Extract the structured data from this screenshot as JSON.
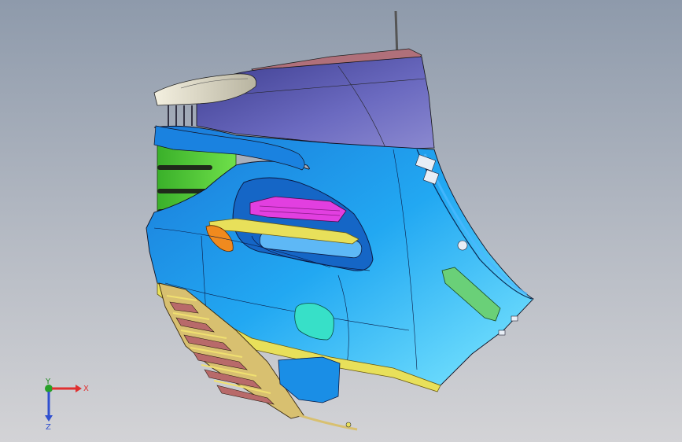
{
  "viewport": {
    "background_top": "#8e9aab",
    "background_bottom": "#d3d3d6"
  },
  "model": {
    "parts": [
      {
        "name": "upper-quarter-panel",
        "color": "#5e5db0"
      },
      {
        "name": "rear-bumper-fascia",
        "color": "#1fa0f0"
      },
      {
        "name": "tail-lamp-housing",
        "color": "#e8e4d0"
      },
      {
        "name": "inner-bracket",
        "color": "#3fc83c"
      },
      {
        "name": "reflector-insert",
        "color": "#e23fe0"
      },
      {
        "name": "trim-strip",
        "color": "#e8e05a"
      },
      {
        "name": "side-marker",
        "color": "#f08a1e"
      },
      {
        "name": "sensor-pad",
        "color": "#37e0c8"
      },
      {
        "name": "mount-bracket",
        "color": "#6ad078"
      },
      {
        "name": "lower-grille",
        "color": "#d8c070"
      }
    ]
  },
  "triad": {
    "x_label": "X",
    "y_label": "Y",
    "z_label": "Z",
    "x_color": "#e03030",
    "y_color": "#30c030",
    "z_color": "#3050d0"
  }
}
